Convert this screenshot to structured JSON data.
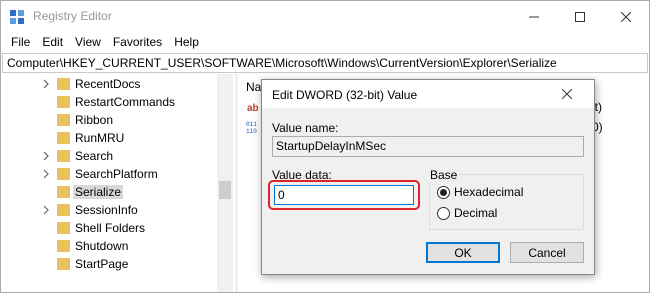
{
  "window": {
    "title": "Registry Editor",
    "minimize_glyph": "—",
    "maximize_glyph": "☐",
    "close_glyph": "✕"
  },
  "menu": [
    "File",
    "Edit",
    "View",
    "Favorites",
    "Help"
  ],
  "address": "Computer\\HKEY_CURRENT_USER\\SOFTWARE\\Microsoft\\Windows\\CurrentVersion\\Explorer\\Serialize",
  "tree": {
    "items": [
      {
        "label": "RecentDocs",
        "expandable": true,
        "selected": false
      },
      {
        "label": "RestartCommands",
        "expandable": false,
        "selected": false
      },
      {
        "label": "Ribbon",
        "expandable": false,
        "selected": false
      },
      {
        "label": "RunMRU",
        "expandable": false,
        "selected": false
      },
      {
        "label": "Search",
        "expandable": true,
        "selected": false
      },
      {
        "label": "SearchPlatform",
        "expandable": true,
        "selected": false
      },
      {
        "label": "Serialize",
        "expandable": false,
        "selected": true
      },
      {
        "label": "SessionInfo",
        "expandable": true,
        "selected": false
      },
      {
        "label": "Shell Folders",
        "expandable": false,
        "selected": false
      },
      {
        "label": "Shutdown",
        "expandable": false,
        "selected": false
      },
      {
        "label": "StartPage",
        "expandable": false,
        "selected": false
      }
    ]
  },
  "values_pane": {
    "column_header": "Na",
    "row1_tail": "et)",
    "row2_tail": "(0)"
  },
  "dialog": {
    "title": "Edit DWORD (32-bit) Value",
    "value_name_label": "Value name:",
    "value_name": "StartupDelayInMSec",
    "value_data_label": "Value data:",
    "value_data": "0",
    "base_label": "Base",
    "base_options": [
      {
        "label": "Hexadecimal",
        "checked": true
      },
      {
        "label": "Decimal",
        "checked": false
      }
    ],
    "ok_label": "OK",
    "cancel_label": "Cancel"
  },
  "colors": {
    "highlight": "#d9252b",
    "focus": "#0078d7",
    "folder": "#e8c35a"
  }
}
